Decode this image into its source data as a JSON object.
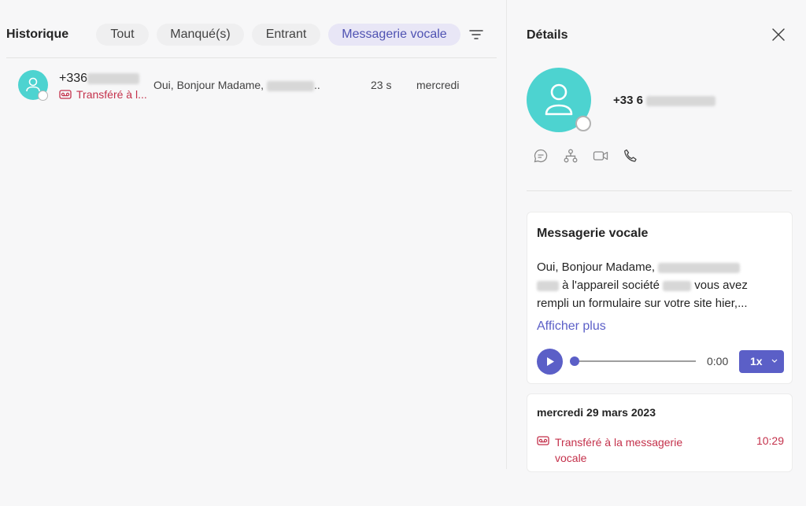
{
  "header": {
    "title": "Historique",
    "tabs": [
      {
        "label": "Tout",
        "active": false
      },
      {
        "label": "Manqué(s)",
        "active": false
      },
      {
        "label": "Entrant",
        "active": false
      },
      {
        "label": "Messagerie vocale",
        "active": true
      }
    ],
    "filter_icon": "filter-icon"
  },
  "call_row": {
    "number_prefix": "+336",
    "status": "Transféré à l...",
    "preview": "Oui, Bonjour Madame,",
    "preview_suffix": "..",
    "duration": "23 s",
    "day": "mercredi"
  },
  "details": {
    "title": "Détails",
    "number": "+33 6",
    "actions": [
      "chat-icon",
      "org-chart-icon",
      "video-call-icon",
      "phone-call-icon"
    ]
  },
  "voicemail": {
    "title": "Messagerie vocale",
    "line1": "Oui, Bonjour Madame,",
    "line2": "à l'appareil société",
    "line2_end": "vous avez",
    "line3": "rempli un formulaire sur votre site hier,...",
    "show_more": "Afficher plus",
    "time": "0:00",
    "speed": "1x",
    "progress": 0
  },
  "history": {
    "date": "mercredi 29 mars 2023",
    "item_label": "Transféré à la messagerie vocale",
    "item_time": "10:29"
  },
  "colors": {
    "accent": "#5b5fc7",
    "avatar": "#4dd3d0",
    "missed": "#c4314b"
  }
}
